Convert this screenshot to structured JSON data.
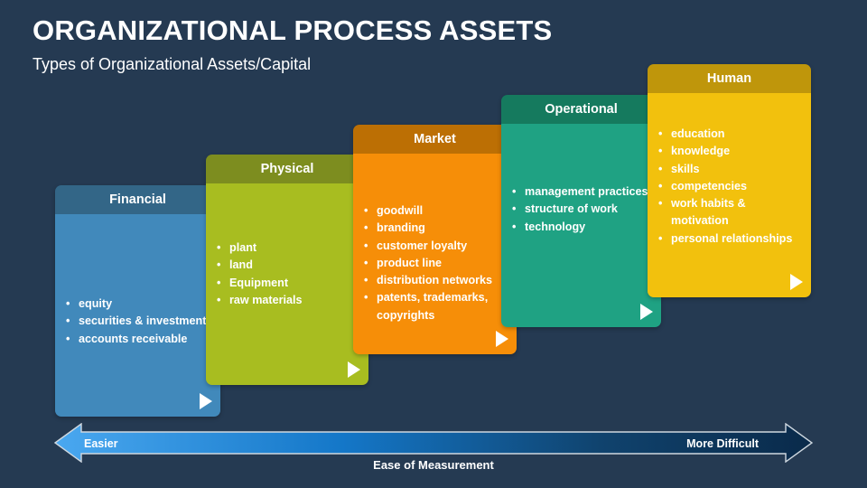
{
  "slide": {
    "title": "ORGANIZATIONAL PROCESS ASSETS",
    "subtitle": "Types of Organizational Assets/Capital",
    "background_color": "#253a52"
  },
  "cards": [
    {
      "key": "financial",
      "title": "Financial",
      "header_color": "#336687",
      "body_color": "#4189bb",
      "items": [
        "equity",
        "securities & investments",
        "accounts receivable"
      ],
      "next_icon": "play-triangle-icon"
    },
    {
      "key": "physical",
      "title": "Physical",
      "header_color": "#7d8d1f",
      "body_color": "#a8bd20",
      "items": [
        "plant",
        "land",
        "Equipment",
        "raw materials"
      ],
      "next_icon": "play-triangle-icon"
    },
    {
      "key": "market",
      "title": "Market",
      "header_color": "#bc6f04",
      "body_color": "#f68e08",
      "items": [
        "goodwill",
        "branding",
        "customer loyalty",
        "product line",
        "distribution networks",
        "patents, trademarks, copyrights"
      ],
      "next_icon": "play-triangle-icon"
    },
    {
      "key": "operational",
      "title": "Operational",
      "header_color": "#157a5e",
      "body_color": "#1fa283",
      "items": [
        "management practices",
        "structure of work",
        "technology"
      ],
      "next_icon": "play-triangle-icon"
    },
    {
      "key": "human",
      "title": "Human",
      "header_color": "#bf960b",
      "body_color": "#f2c10d",
      "items": [
        "education",
        "knowledge",
        "skills",
        "competencies",
        "work habits & motivation",
        "personal relationships"
      ],
      "next_icon": "play-triangle-icon"
    }
  ],
  "ease_scale": {
    "left_label": "Easier",
    "right_label": "More Difficult",
    "caption": "Ease of Measurement",
    "gradient_start_color": "#4aa8f0",
    "gradient_end_color": "#0a2a4a",
    "outline_color": "#cfd8e0",
    "icon_left": "arrow-left-icon",
    "icon_right": "arrow-right-icon"
  }
}
